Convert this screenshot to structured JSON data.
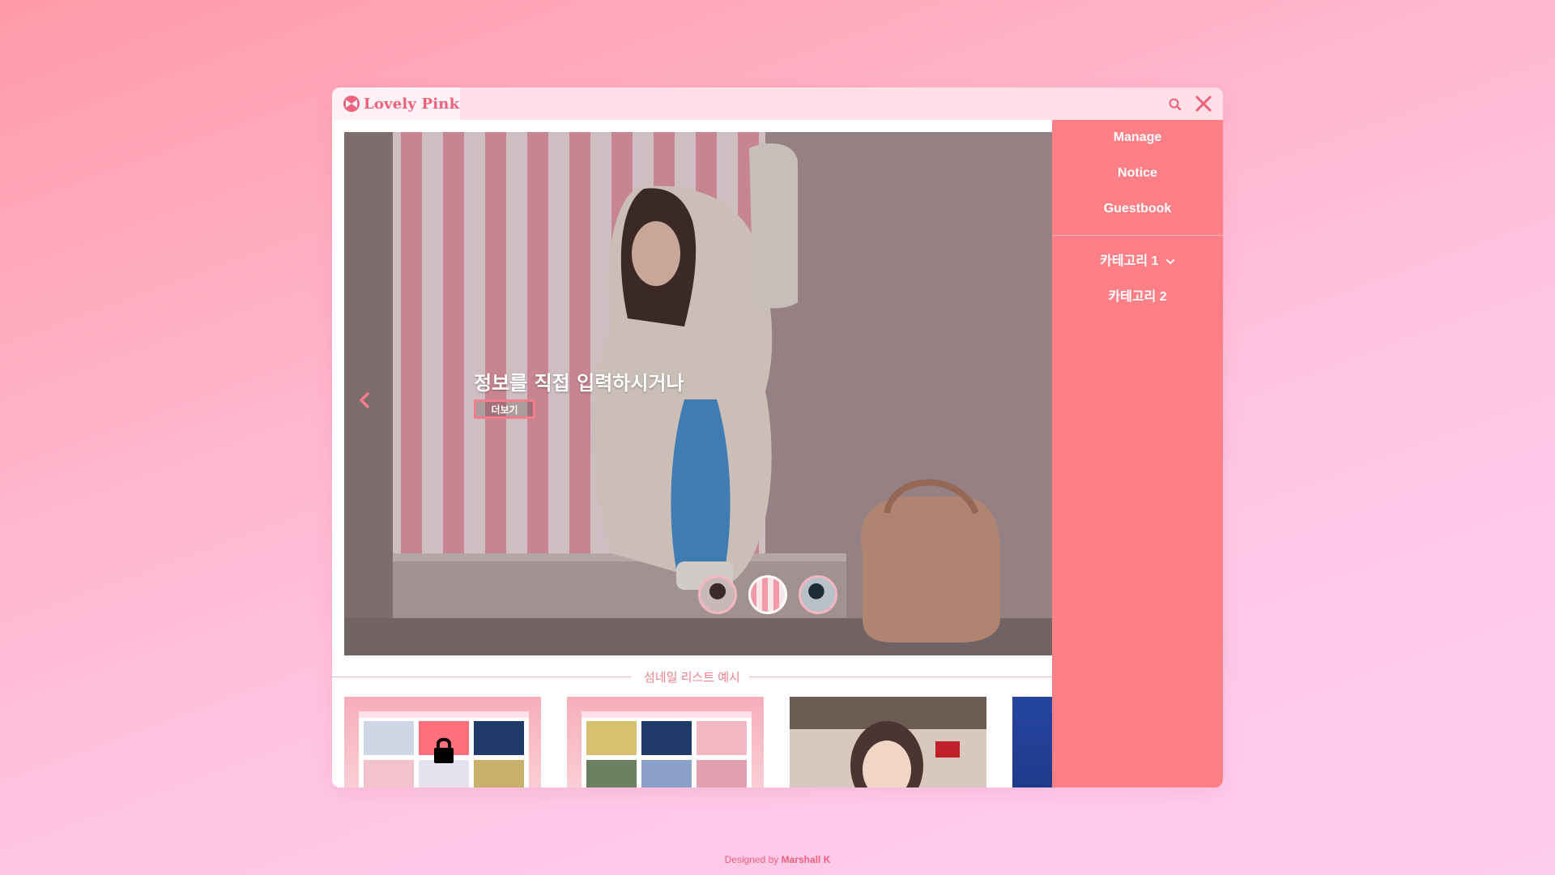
{
  "window": {
    "logo_text": "Lovely Pink"
  },
  "sidebar": {
    "items": [
      {
        "label": "Manage"
      },
      {
        "label": "Notice"
      },
      {
        "label": "Guestbook"
      }
    ],
    "categories": [
      {
        "label": "카테고리 1",
        "has_dropdown": true
      },
      {
        "label": "카테고리 2",
        "has_dropdown": false
      }
    ]
  },
  "slider": {
    "caption": "정보를 직접 입력하시거나",
    "more_label": "더보기",
    "dots_count": 3,
    "active_dot": 2
  },
  "section": {
    "title": "섬네일 리스트 예시"
  },
  "footer": {
    "prefix": "Designed by ",
    "author": "Marshall K"
  },
  "colors": {
    "accent": "#ff7f86",
    "logo": "#f0607a",
    "titlebar": "#ffe0e9"
  },
  "icons": [
    "logo-icon",
    "search-icon",
    "close-icon",
    "chevron-left-icon",
    "chevron-down-icon",
    "lock-icon"
  ]
}
